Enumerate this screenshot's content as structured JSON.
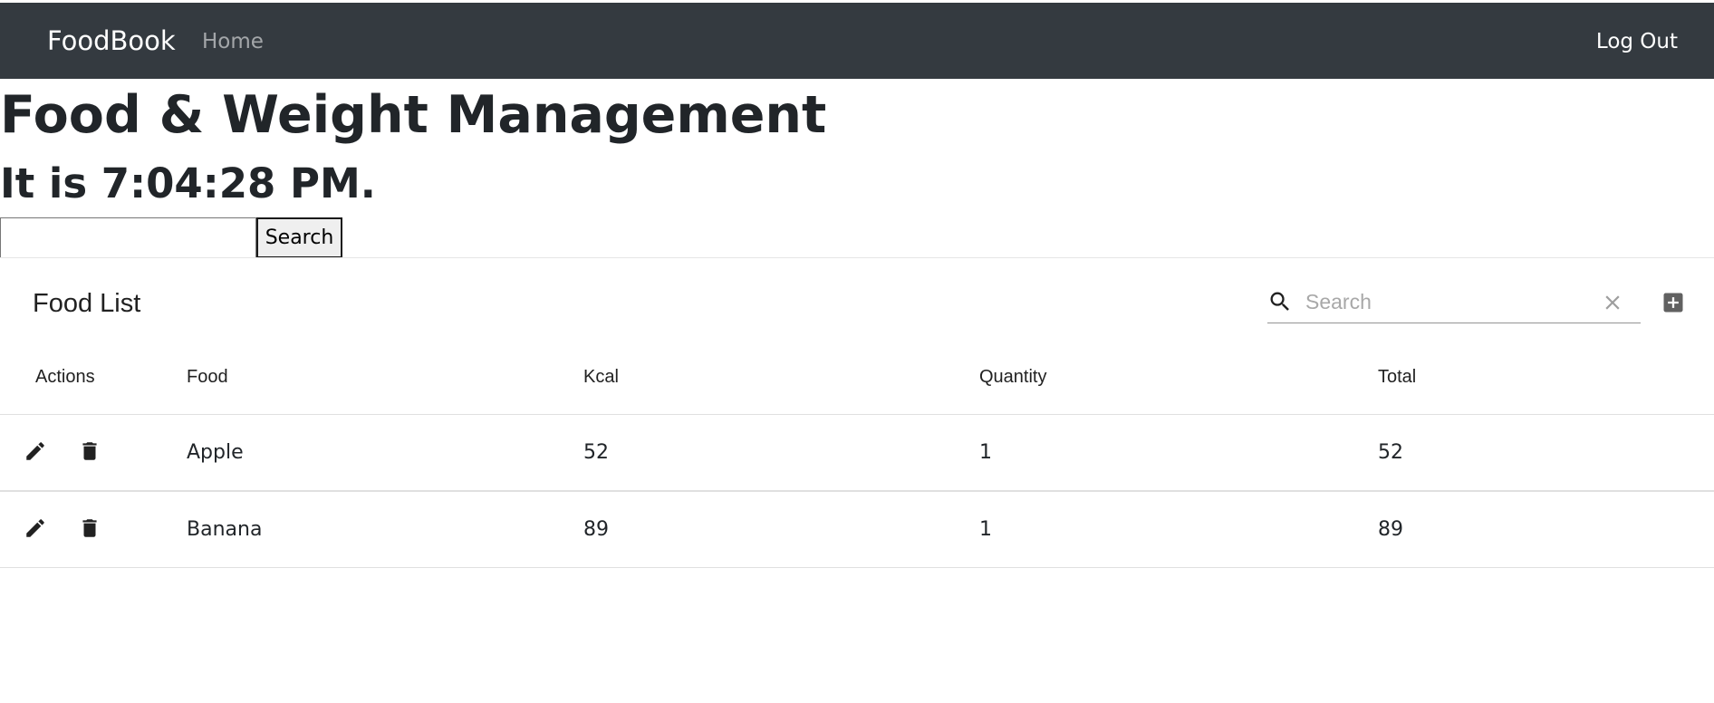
{
  "navbar": {
    "brand": "FoodBook",
    "home_label": "Home",
    "logout_label": "Log Out"
  },
  "page": {
    "title": "Food & Weight Management",
    "time_text": "It is 7:04:28 PM."
  },
  "search_form": {
    "value": "",
    "button_label": "Search"
  },
  "food_table": {
    "title": "Food List",
    "search_placeholder": "Search",
    "columns": {
      "actions": "Actions",
      "food": "Food",
      "kcal": "Kcal",
      "quantity": "Quantity",
      "total": "Total"
    },
    "rows": [
      {
        "food": "Apple",
        "kcal": "52",
        "quantity": "1",
        "total": "52"
      },
      {
        "food": "Banana",
        "kcal": "89",
        "quantity": "1",
        "total": "89"
      }
    ],
    "icons": {
      "search": "search-icon",
      "clear": "close-icon",
      "add": "add-box-icon",
      "edit": "pencil-icon",
      "delete": "trash-icon"
    }
  },
  "colors": {
    "navbar_bg": "#343a40",
    "nav_muted": "rgba(255,255,255,0.55)",
    "text": "#212529",
    "icon": "#212121",
    "add_icon": "#616161"
  }
}
